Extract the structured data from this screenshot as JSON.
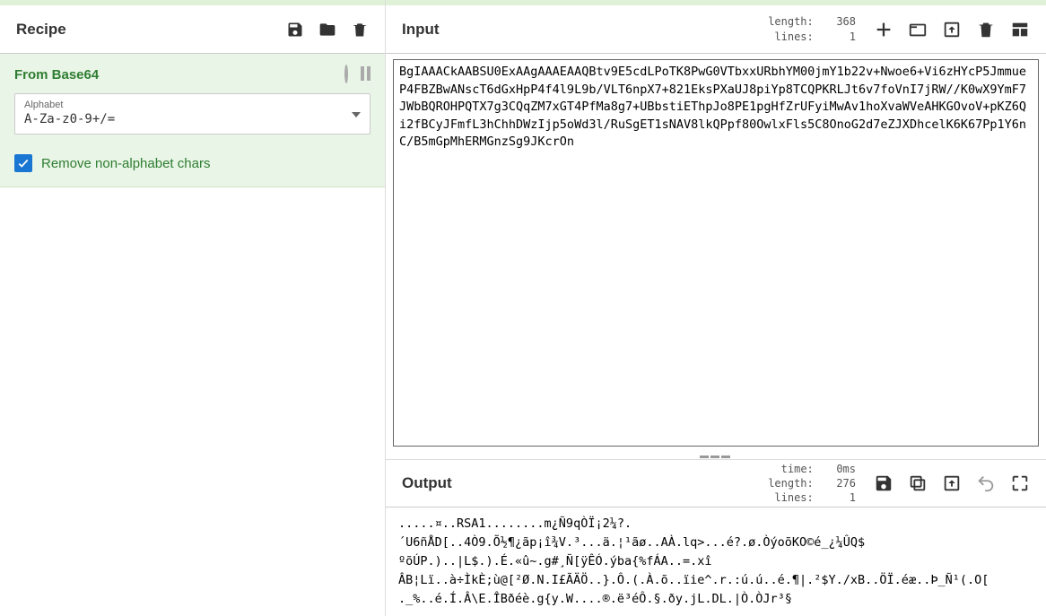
{
  "recipe": {
    "title": "Recipe",
    "operation": {
      "name": "From Base64",
      "alphabet_label": "Alphabet",
      "alphabet_value": "A-Za-z0-9+/=",
      "checkbox_label": "Remove non-alphabet chars",
      "checkbox_checked": true
    }
  },
  "input": {
    "title": "Input",
    "stats": {
      "length_label": "length:",
      "length_value": "368",
      "lines_label": "lines:",
      "lines_value": "1"
    },
    "text": "BgIAAACkAABSU0ExAAgAAAEAAQBtv9E5cdLPoTK8PwG0VTbxxURbhYM00jmY1b22v+Nwoe6+Vi6zHYcP5JmmueP4FBZBwANscT6dGxHpP4f4l9L9b/VLT6npX7+821EksPXaUJ8piYp8TCQPKRLJt6v7foVnI7jRW//K0wX9YmF7JWbBQROHPQTX7g3CQqZM7xGT4PfMa8g7+UBbstiEThpJo8PE1pgHfZrUFyiMwAv1hoXvaWVeAHKGOvoV+pKZ6Qi2fBCyJFmfL3hChhDWzIjp5oWd3l/RuSgET1sNAV8lkQPpf80OwlxFls5C8OnoG2d7eZJXDhcelK6K67Pp1Y6nC/B5mGpMhERMGnzSg9JKcrOn"
  },
  "output": {
    "title": "Output",
    "stats": {
      "time_label": "time:",
      "time_value": "0ms",
      "length_label": "length:",
      "length_value": "276",
      "lines_label": "lines:",
      "lines_value": "1"
    },
    "text": ".....¤..RSA1........m¿Ñ9qÒÏ¡2¼?.\n´U6ñÅD[..4Ò9.Õ½¶¿ãp¡î¾V.³...ä.¦¹ãø..AÀ.lq>...é?.ø.ÒýoõKO©é_¿¼ÛQ$\nºõÚP.)..|L$.).É.«û~.g#¸Ñ[ÿÊÓ.ýba{%fÁA..=.xî\nÂB¦Lï..à÷ÌkÈ;ù@[²Ø.N.I£ÃÄÖ..}.Ô.(.À.õ..ïie^.r.:ú.ú..é.¶|.²$Y./xB..ÖÏ.éæ..Þ_Ñ¹(.O[\n._%..é.Í.Â\\E.ÎBðéè.g{y.W....®.ë³éÔ.§.ðy.jL.DL.|Ò.ÒJr³§"
  }
}
